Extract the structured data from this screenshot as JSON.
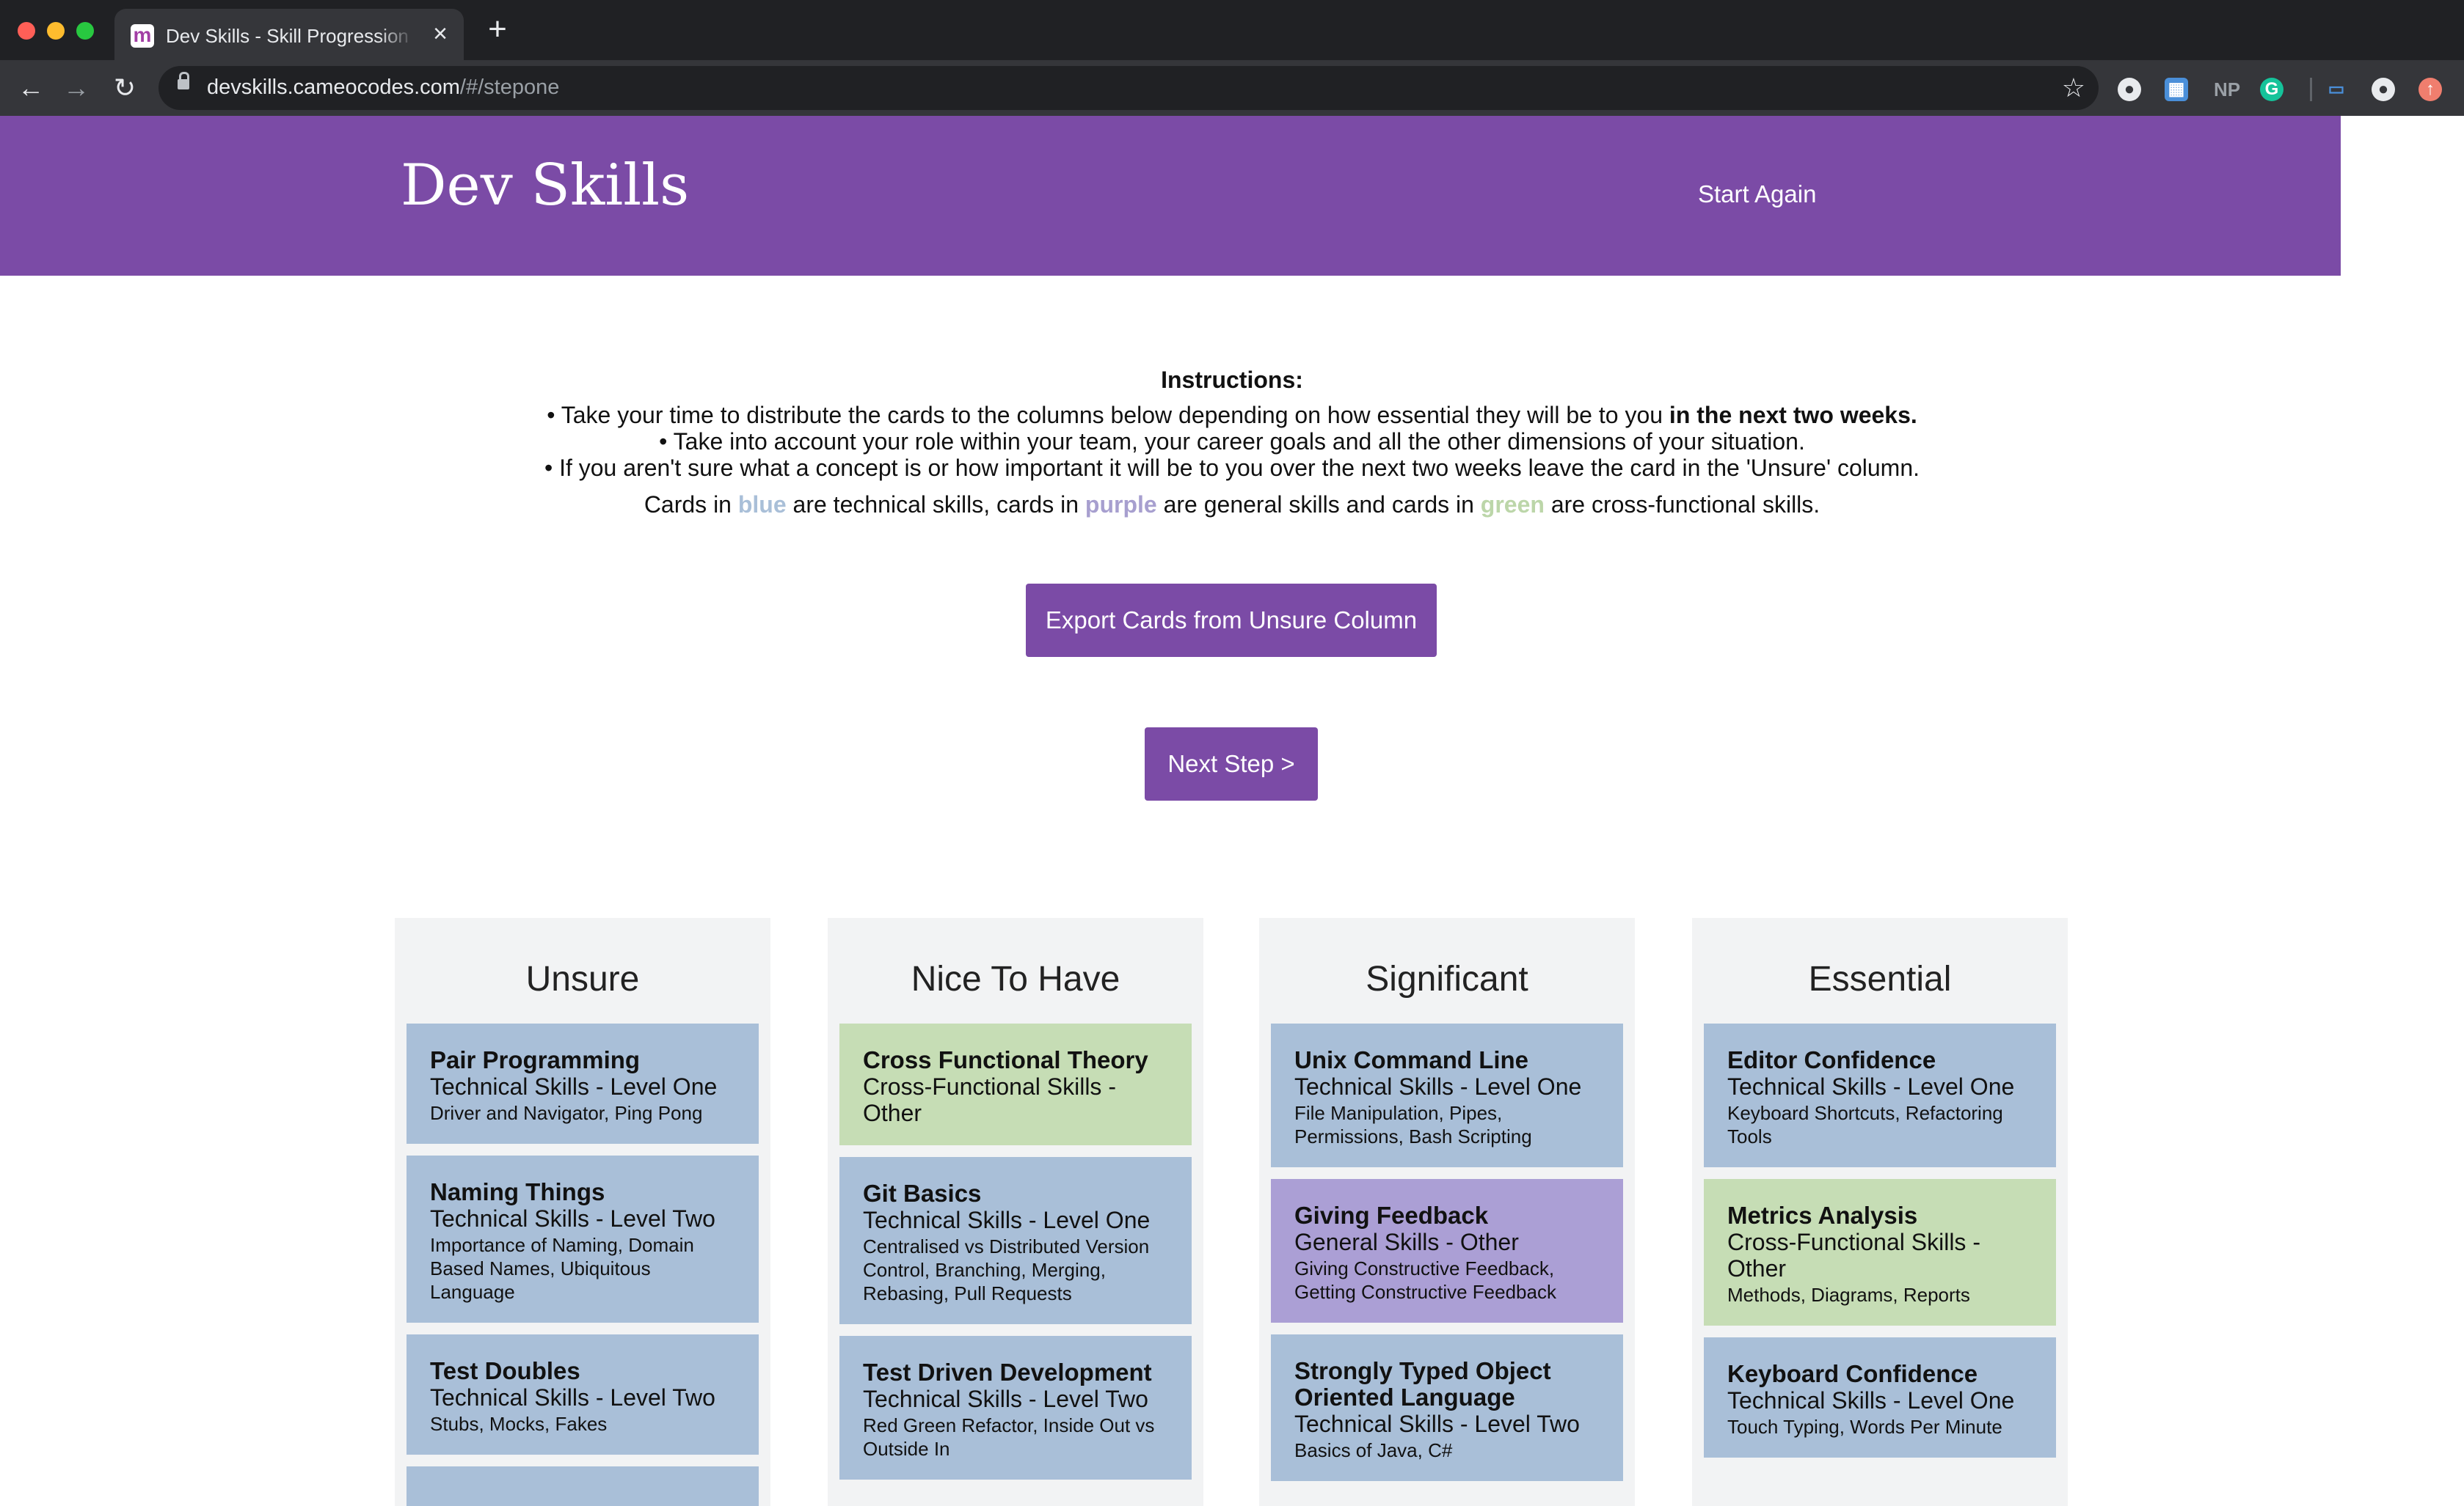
{
  "browser": {
    "tab_title": "Dev Skills - Skill Progression and Prioritisation",
    "url_host": "devskills.cameocodes.com",
    "url_path": "/#/stepone",
    "favicon_letter": "m"
  },
  "header": {
    "brand": "Dev Skills",
    "start_again": "Start Again"
  },
  "instructions": {
    "heading": "Instructions:",
    "line1_prefix": "• Take your time to distribute the cards to the columns below depending on how essential they will be to you ",
    "line1_bold": "in the next two weeks.",
    "line2": "• Take into account your role within your team, your career goals and all the other dimensions of your situation.",
    "line3": "• If you aren't sure what a concept is or how important it will be to you over the next two weeks leave the card in the 'Unsure' column.",
    "legend_1": "Cards in ",
    "legend_blue": "blue",
    "legend_2": " are technical skills, cards in ",
    "legend_purple": "purple",
    "legend_3": " are general skills and cards in ",
    "legend_green": "green",
    "legend_4": " are cross-functional skills."
  },
  "buttons": {
    "export": "Export Cards from Unsure Column",
    "next": "Next Step >"
  },
  "colors": {
    "brand_purple": "#7b4ba6",
    "technical_blue": "#a9bfd8",
    "general_purple": "#ab9fd5",
    "crossfunctional_green": "#c6ddb5"
  },
  "columns": [
    {
      "title": "Unsure",
      "cards": [
        {
          "type": "blue",
          "title": "Pair Programming",
          "category": "Technical Skills - Level One",
          "desc": "Driver and Navigator, Ping Pong"
        },
        {
          "type": "blue",
          "title": "Naming Things",
          "category": "Technical Skills - Level Two",
          "desc": "Importance of Naming, Domain Based Names, Ubiquitous Language"
        },
        {
          "type": "blue",
          "title": "Test Doubles",
          "category": "Technical Skills - Level Two",
          "desc": "Stubs, Mocks, Fakes"
        },
        {
          "type": "blue",
          "title": "",
          "category": "",
          "desc": ""
        }
      ]
    },
    {
      "title": "Nice To Have",
      "cards": [
        {
          "type": "green",
          "title": "Cross Functional Theory",
          "category": "Cross-Functional Skills - Other",
          "desc": ""
        },
        {
          "type": "blue",
          "title": "Git Basics",
          "category": "Technical Skills - Level One",
          "desc": "Centralised vs Distributed Version Control, Branching, Merging, Rebasing, Pull Requests"
        },
        {
          "type": "blue",
          "title": "Test Driven Development",
          "category": "Technical Skills - Level Two",
          "desc": "Red Green Refactor, Inside Out vs Outside In"
        }
      ]
    },
    {
      "title": "Significant",
      "cards": [
        {
          "type": "blue",
          "title": "Unix Command Line",
          "category": "Technical Skills - Level One",
          "desc": "File Manipulation, Pipes, Permissions, Bash Scripting"
        },
        {
          "type": "purple",
          "title": "Giving Feedback",
          "category": "General Skills - Other",
          "desc": "Giving Constructive Feedback, Getting Constructive Feedback"
        },
        {
          "type": "blue",
          "title": "Strongly Typed Object Oriented Language",
          "category": "Technical Skills - Level Two",
          "desc": "Basics of Java, C#"
        }
      ]
    },
    {
      "title": "Essential",
      "cards": [
        {
          "type": "blue",
          "title": "Editor Confidence",
          "category": "Technical Skills - Level One",
          "desc": "Keyboard Shortcuts, Refactoring Tools"
        },
        {
          "type": "green",
          "title": "Metrics Analysis",
          "category": "Cross-Functional Skills - Other",
          "desc": "Methods, Diagrams, Reports"
        },
        {
          "type": "blue",
          "title": "Keyboard Confidence",
          "category": "Technical Skills - Level One",
          "desc": "Touch Typing, Words Per Minute"
        }
      ]
    }
  ]
}
